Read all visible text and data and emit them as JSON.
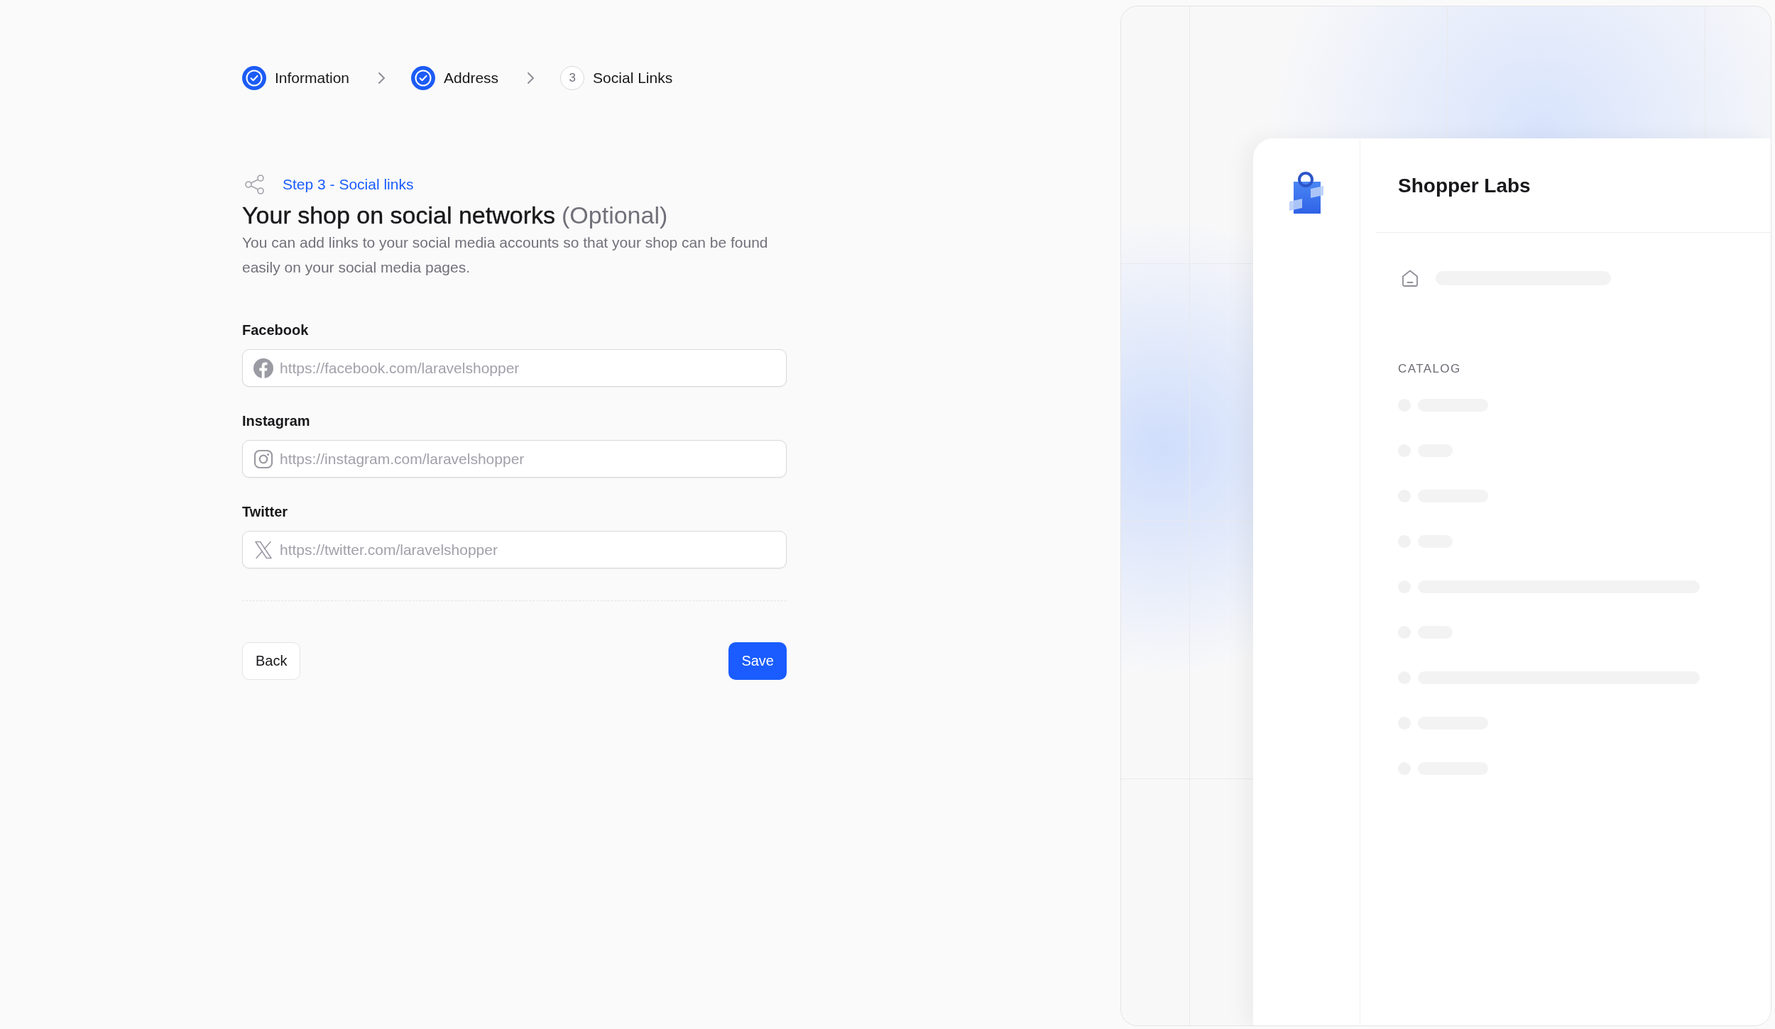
{
  "stepper": {
    "steps": [
      {
        "label": "Information",
        "completed": true
      },
      {
        "label": "Address",
        "completed": true
      },
      {
        "label": "Social Links",
        "number": "3",
        "completed": false
      }
    ]
  },
  "section": {
    "eyebrow": "Step 3 - Social links",
    "title": "Your shop on social networks",
    "title_note": "(Optional)",
    "description": "You can add links to your social media accounts so that your shop can be found easily on your social media pages."
  },
  "fields": [
    {
      "label": "Facebook",
      "kind": "facebook",
      "placeholder": "https://facebook.com/laravelshopper"
    },
    {
      "label": "Instagram",
      "kind": "instagram",
      "placeholder": "https://instagram.com/laravelshopper"
    },
    {
      "label": "Twitter",
      "kind": "x",
      "placeholder": "https://twitter.com/laravelshopper"
    }
  ],
  "buttons": [
    {
      "label": "Back",
      "kind": "secondary"
    },
    {
      "label": "Save",
      "kind": "primary"
    }
  ],
  "preview": {
    "shop_name": "Shopper Labs",
    "section_label": "CATALOG",
    "items": [
      {
        "kind": "medium"
      },
      {
        "kind": "short"
      },
      {
        "kind": "medium"
      },
      {
        "kind": "short"
      },
      {
        "kind": "long"
      },
      {
        "kind": "short"
      },
      {
        "kind": "long"
      },
      {
        "kind": "medium"
      },
      {
        "kind": "medium"
      }
    ]
  }
}
